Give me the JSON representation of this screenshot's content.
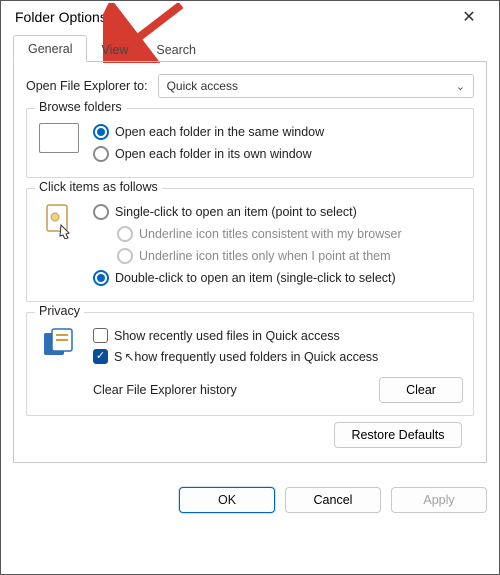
{
  "window": {
    "title": "Folder Options"
  },
  "tabs": {
    "general": "General",
    "view": "View",
    "search": "Search"
  },
  "open_to": {
    "label": "Open File Explorer to:",
    "value": "Quick access"
  },
  "browse": {
    "title": "Browse folders",
    "opt_same": "Open each folder in the same window",
    "opt_own": "Open each folder in its own window"
  },
  "click": {
    "title": "Click items as follows",
    "opt_single": "Single-click to open an item (point to select)",
    "opt_underline_browser": "Underline icon titles consistent with my browser",
    "opt_underline_point": "Underline icon titles only when I point at them",
    "opt_double": "Double-click to open an item (single-click to select)"
  },
  "privacy": {
    "title": "Privacy",
    "opt_recent": "Show recently used files in Quick access",
    "opt_frequent": "Show frequently used folders in Quick access",
    "clear_label": "Clear File Explorer history",
    "clear_btn": "Clear"
  },
  "buttons": {
    "restore": "Restore Defaults",
    "ok": "OK",
    "cancel": "Cancel",
    "apply": "Apply"
  }
}
